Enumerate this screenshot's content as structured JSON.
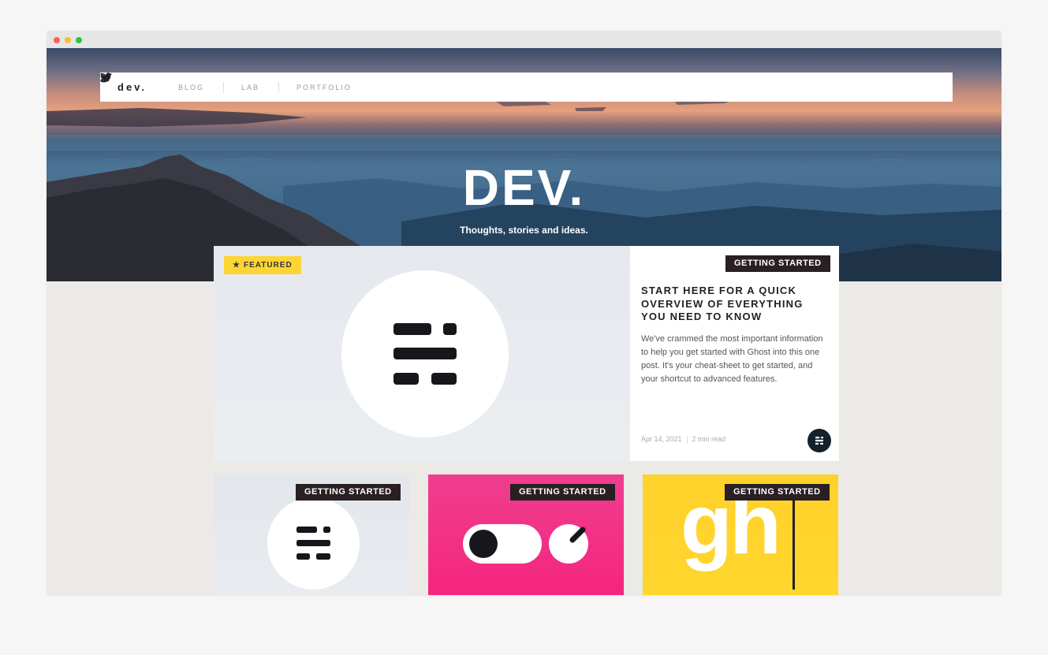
{
  "nav": {
    "logo": "dev.",
    "items": [
      {
        "label": "BLOG"
      },
      {
        "label": "LAB"
      },
      {
        "label": "PORTFOLIO"
      }
    ]
  },
  "hero": {
    "title": "DEV.",
    "subtitle": "Thoughts, stories and ideas."
  },
  "featured_post": {
    "badge": "FEATURED",
    "tag": "GETTING STARTED",
    "title": "START HERE FOR A QUICK OVERVIEW OF EVERYTHING YOU NEED TO KNOW",
    "excerpt": "We've crammed the most important information to help you get started with Ghost into this one post. It's your cheat-sheet to get started, and your shortcut to advanced features.",
    "date": "Apr 14, 2021",
    "read_time": "2 min read"
  },
  "cards": [
    {
      "tag": "GETTING STARTED"
    },
    {
      "tag": "GETTING STARTED"
    },
    {
      "tag": "GETTING STARTED",
      "image_text": "gh"
    }
  ],
  "colors": {
    "featured_badge": "#fcd534",
    "tag_bg": "#2a1f23",
    "card_pink": "#f4257f",
    "card_yellow": "#ffd62e"
  }
}
